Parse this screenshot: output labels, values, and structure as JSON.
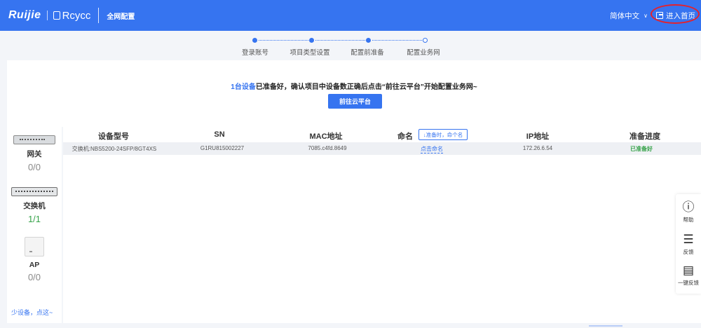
{
  "header": {
    "logo_text": "Ruijie",
    "brand_text": "Rcycc",
    "app_title": "全网配置",
    "language": "简体中文",
    "home_button_label": "进入首页"
  },
  "stepper": {
    "steps": [
      {
        "label": "登录账号"
      },
      {
        "label": "项目类型设置"
      },
      {
        "label": "配置前准备"
      },
      {
        "label": "配置业务网"
      }
    ]
  },
  "banner": {
    "count_text": "1台设备",
    "message_text": "已准备好，确认项目中设备数正确后点击“前往云平台”开始配置业务网~",
    "button_label": "前往云平台"
  },
  "devices": {
    "gateway": {
      "name": "网关",
      "count": "0/0"
    },
    "switch": {
      "name": "交换机",
      "count": "1/1"
    },
    "ap": {
      "name": "AP",
      "count": "0/0"
    },
    "fewer_link": "少设备，点这~"
  },
  "table": {
    "headers": {
      "model": "设备型号",
      "sn": "SN",
      "mac": "MAC地址",
      "name": "命名",
      "name_tip": "↓准备时，命个名",
      "ip": "IP地址",
      "progress": "准备进度"
    },
    "rows": [
      {
        "model": "交换机:NBS5200-24SFP/8GT4XS",
        "sn": "G1RU815002227",
        "mac": "7085.c4fd.8649",
        "name_action": "点击命名",
        "ip": "172.26.6.54",
        "status": "已准备好"
      }
    ]
  },
  "side_tools": {
    "help": "帮助",
    "feedback": "反馈",
    "one_click_feedback": "一键反馈"
  },
  "colors": {
    "primary": "#3674f0",
    "success": "#37a34a",
    "highlight_ring": "#e5212b"
  }
}
